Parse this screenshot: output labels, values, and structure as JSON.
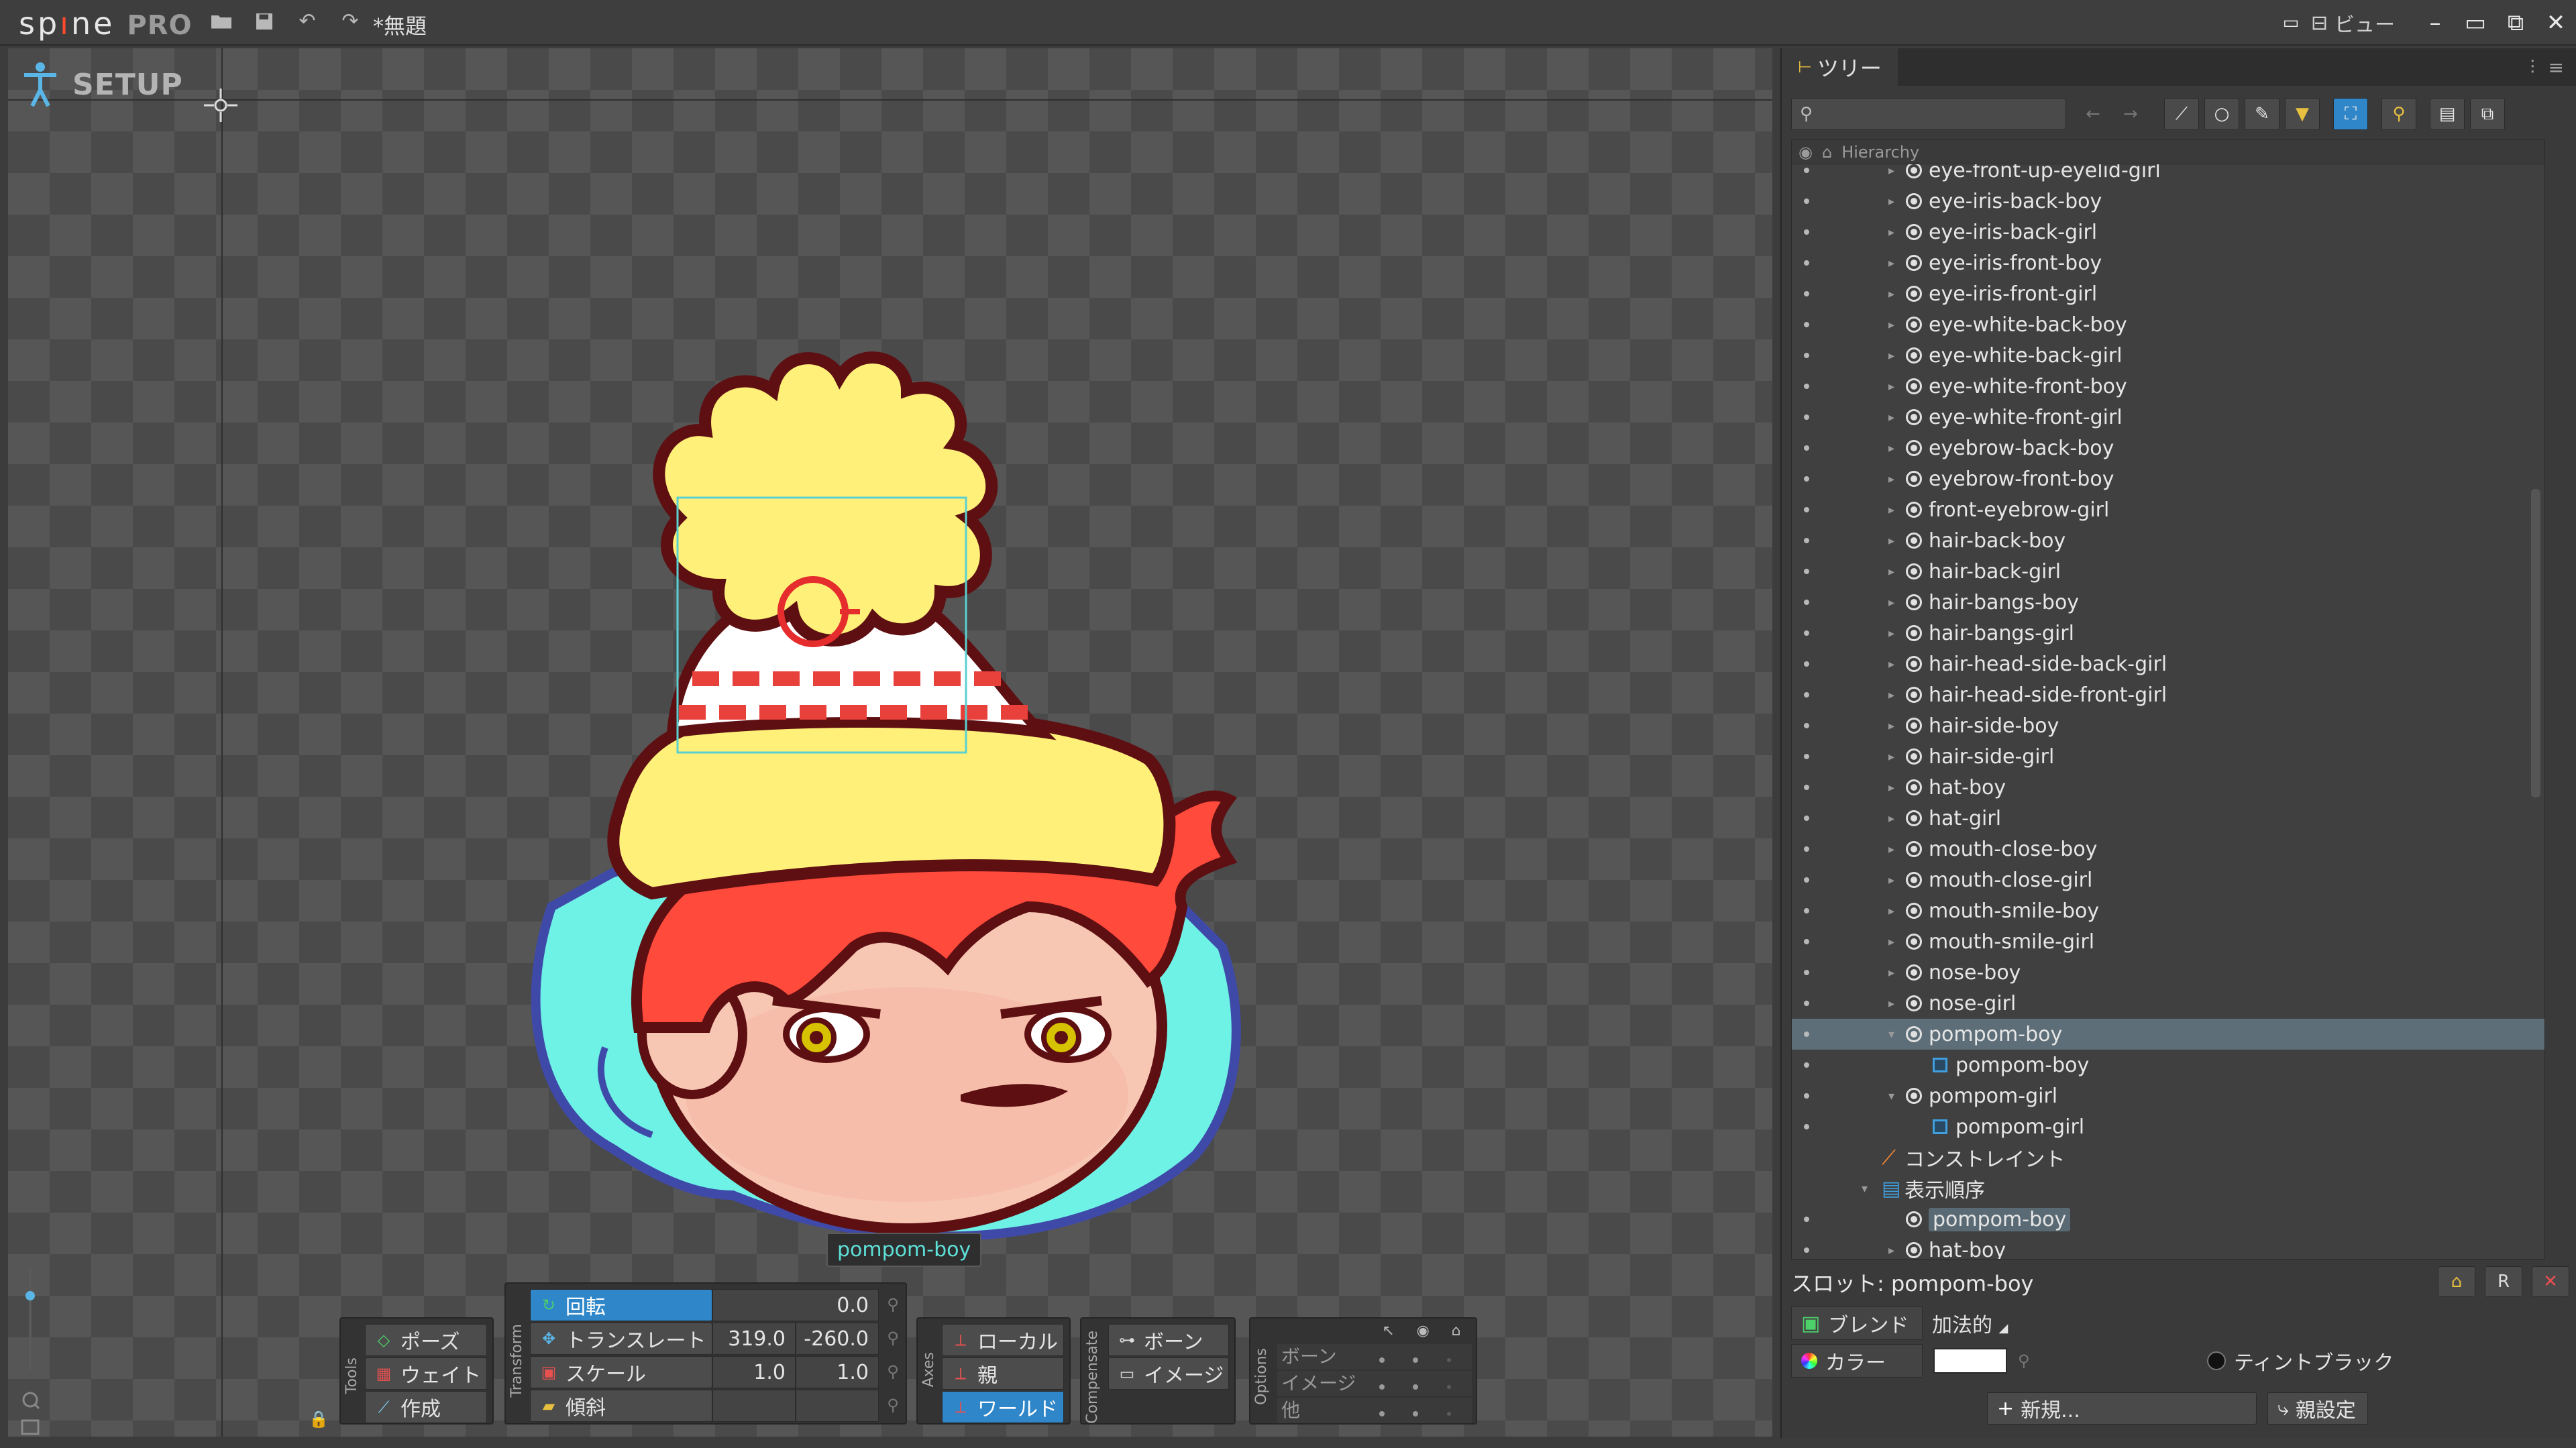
{
  "app": {
    "logo_text": "sp",
    "logo_dot": "ı",
    "logo_rest": "ne",
    "edition": "PRO",
    "document_title": "*無題",
    "view_menu": "ビュー"
  },
  "viewport": {
    "mode_label": "SETUP",
    "selected_bone_label": "pompom-boy"
  },
  "tools": {
    "group_label": "Tools",
    "pose": "ポーズ",
    "weight": "ウェイト",
    "create": "作成"
  },
  "transform": {
    "group_label": "Transform",
    "rotate": {
      "label": "回転",
      "value": "0.0"
    },
    "translate": {
      "label": "トランスレート",
      "x": "319.0",
      "y": "-260.0"
    },
    "scale": {
      "label": "スケール",
      "x": "1.0",
      "y": "1.0"
    },
    "shear": {
      "label": "傾斜"
    }
  },
  "axes": {
    "group_label": "Axes",
    "local": "ローカル",
    "parent": "親",
    "world": "ワールド"
  },
  "compensate": {
    "group_label": "Compensate",
    "bone": "ボーン",
    "image": "イメージ"
  },
  "options": {
    "group_label": "Options",
    "rows": [
      "ボーン",
      "イメージ",
      "他"
    ]
  },
  "tree_panel": {
    "tab_label": "ツリー",
    "column_header": "Hierarchy",
    "search_placeholder": "",
    "items": [
      {
        "label": "eye-front-up-eyelid-girl",
        "type": "slot",
        "indent": 1
      },
      {
        "label": "eye-iris-back-boy",
        "type": "slot",
        "indent": 1
      },
      {
        "label": "eye-iris-back-girl",
        "type": "slot",
        "indent": 1
      },
      {
        "label": "eye-iris-front-boy",
        "type": "slot",
        "indent": 1
      },
      {
        "label": "eye-iris-front-girl",
        "type": "slot",
        "indent": 1
      },
      {
        "label": "eye-white-back-boy",
        "type": "slot",
        "indent": 1
      },
      {
        "label": "eye-white-back-girl",
        "type": "slot",
        "indent": 1
      },
      {
        "label": "eye-white-front-boy",
        "type": "slot",
        "indent": 1
      },
      {
        "label": "eye-white-front-girl",
        "type": "slot",
        "indent": 1
      },
      {
        "label": "eyebrow-back-boy",
        "type": "slot",
        "indent": 1
      },
      {
        "label": "eyebrow-front-boy",
        "type": "slot",
        "indent": 1
      },
      {
        "label": "front-eyebrow-girl",
        "type": "slot",
        "indent": 1
      },
      {
        "label": "hair-back-boy",
        "type": "slot",
        "indent": 1
      },
      {
        "label": "hair-back-girl",
        "type": "slot",
        "indent": 1
      },
      {
        "label": "hair-bangs-boy",
        "type": "slot",
        "indent": 1
      },
      {
        "label": "hair-bangs-girl",
        "type": "slot",
        "indent": 1
      },
      {
        "label": "hair-head-side-back-girl",
        "type": "slot",
        "indent": 1
      },
      {
        "label": "hair-head-side-front-girl",
        "type": "slot",
        "indent": 1
      },
      {
        "label": "hair-side-boy",
        "type": "slot",
        "indent": 1
      },
      {
        "label": "hair-side-girl",
        "type": "slot",
        "indent": 1
      },
      {
        "label": "hat-boy",
        "type": "slot",
        "indent": 1
      },
      {
        "label": "hat-girl",
        "type": "slot",
        "indent": 1
      },
      {
        "label": "mouth-close-boy",
        "type": "slot",
        "indent": 1
      },
      {
        "label": "mouth-close-girl",
        "type": "slot",
        "indent": 1
      },
      {
        "label": "mouth-smile-boy",
        "type": "slot",
        "indent": 1
      },
      {
        "label": "mouth-smile-girl",
        "type": "slot",
        "indent": 1
      },
      {
        "label": "nose-boy",
        "type": "slot",
        "indent": 1
      },
      {
        "label": "nose-girl",
        "type": "slot",
        "indent": 1
      },
      {
        "label": "pompom-boy",
        "type": "slot-open",
        "indent": 1,
        "selected": true
      },
      {
        "label": "pompom-boy",
        "type": "region",
        "indent": 2
      },
      {
        "label": "pompom-girl",
        "type": "slot-open",
        "indent": 1
      },
      {
        "label": "pompom-girl",
        "type": "region",
        "indent": 2
      },
      {
        "label": "コンストレイント",
        "type": "constraint",
        "indent": 0
      },
      {
        "label": "表示順序",
        "type": "draworder",
        "indent": 0
      },
      {
        "label": "pompom-boy",
        "type": "slot-hl",
        "indent": 1
      },
      {
        "label": "hat-boy",
        "type": "slot",
        "indent": 1
      }
    ]
  },
  "slot_panel": {
    "title": "スロット: pompom-boy",
    "blend_label": "ブレンド",
    "blend_value": "加法的",
    "color_label": "カラー",
    "color_value": "#ffffff",
    "tint_black_label": "ティントブラック",
    "new_button": "新規...",
    "set_parent_button": "親設定"
  },
  "colors": {
    "accent": "#2f86c8",
    "selection_row": "#5d6e78",
    "bone_label_text": "#5ee0d8"
  }
}
